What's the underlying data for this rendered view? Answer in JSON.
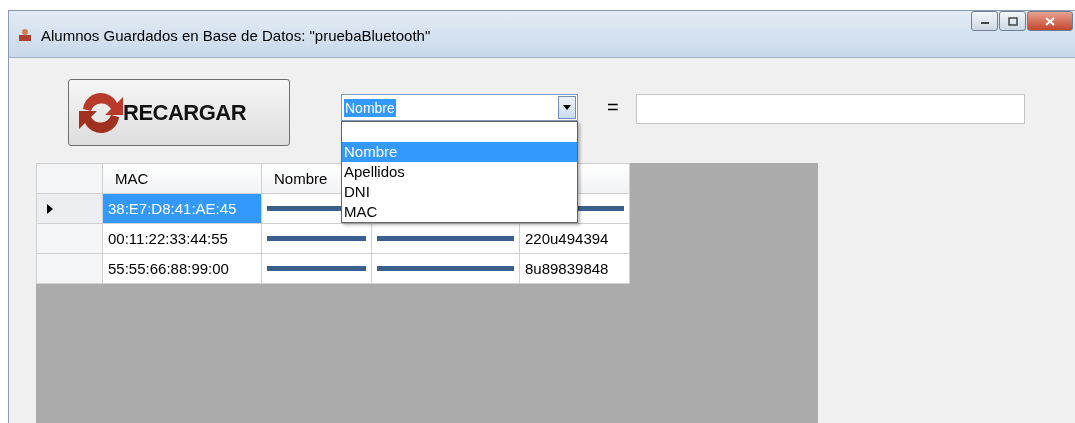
{
  "window": {
    "title": "Alumnos Guardados en Base de Datos: \"pruebaBluetooth\""
  },
  "reload_button": {
    "label": "RECARGAR"
  },
  "filter": {
    "field": {
      "value": "Nombre",
      "expanded": true,
      "options": [
        {
          "label": "Nombre",
          "selected": true
        },
        {
          "label": "Apellidos",
          "selected": false
        },
        {
          "label": "DNI",
          "selected": false
        },
        {
          "label": "MAC",
          "selected": false
        }
      ]
    },
    "operator": "="
  },
  "table": {
    "columns": [
      "MAC",
      "Nombre"
    ],
    "rows": [
      {
        "current": true,
        "cells": [
          {
            "text": "38:E7:D8:41:AE:45",
            "selected": true,
            "redacted": false
          },
          {
            "selected": false,
            "redacted": true
          },
          null,
          {
            "selected": false,
            "redacted": true
          }
        ]
      },
      {
        "current": false,
        "cells": [
          {
            "text": "00:11:22:33:44:55",
            "selected": false,
            "redacted": false
          },
          {
            "selected": false,
            "redacted": true
          },
          {
            "selected": false,
            "redacted": true
          },
          {
            "text": "220u494394",
            "selected": false,
            "redacted": false
          }
        ]
      },
      {
        "current": false,
        "cells": [
          {
            "text": "55:55:66:88:99:00",
            "selected": false,
            "redacted": false
          },
          {
            "selected": false,
            "redacted": true
          },
          {
            "selected": false,
            "redacted": true
          },
          {
            "text": "8u89839848",
            "selected": false,
            "redacted": false
          }
        ]
      }
    ]
  }
}
